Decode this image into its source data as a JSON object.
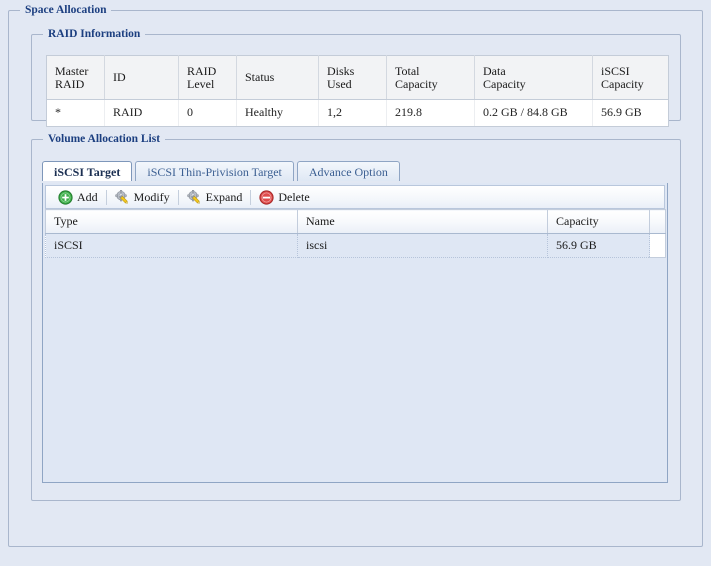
{
  "page": {
    "background": "#e2e8f3"
  },
  "space_allocation": {
    "legend": "Space Allocation",
    "raid_information": {
      "legend": "RAID Information",
      "columns": [
        {
          "line1": "Master",
          "line2": "RAID"
        },
        {
          "line1": "ID",
          "line2": ""
        },
        {
          "line1": "RAID",
          "line2": "Level"
        },
        {
          "line1": "Status",
          "line2": ""
        },
        {
          "line1": "Disks",
          "line2": "Used"
        },
        {
          "line1": "Total",
          "line2": "Capacity"
        },
        {
          "line1": "Data",
          "line2": "Capacity"
        },
        {
          "line1": "iSCSI",
          "line2": "Capacity"
        }
      ],
      "rows": [
        {
          "master_raid": "*",
          "id": "RAID",
          "raid_level": "0",
          "status": "Healthy",
          "disks_used": "1,2",
          "total_capacity": "219.8",
          "data_capacity": "0.2 GB / 84.8 GB",
          "iscsi_capacity": "56.9 GB"
        }
      ]
    },
    "volume_allocation_list": {
      "legend": "Volume Allocation List",
      "tabs": [
        {
          "label": "iSCSI Target",
          "active": true
        },
        {
          "label": "iSCSI Thin-Privision Target",
          "active": false
        },
        {
          "label": "Advance Option",
          "active": false
        }
      ],
      "toolbar": {
        "add_label": "Add",
        "modify_label": "Modify",
        "expand_label": "Expand",
        "delete_label": "Delete",
        "icons": {
          "add": "plus-circle-green-icon",
          "modify": "gear-pencil-icon",
          "expand": "gear-pencil-icon",
          "delete": "minus-circle-red-icon"
        },
        "colors": {
          "add_green": "#2e9c3a",
          "delete_red": "#d03a3a",
          "gear_gray": "#b9bdc4",
          "pencil_yellow": "#f0c419"
        }
      },
      "grid": {
        "columns": [
          "Type",
          "Name",
          "Capacity"
        ],
        "rows": [
          {
            "type": "iSCSI",
            "name": "iscsi",
            "capacity": "56.9 GB"
          }
        ]
      }
    }
  }
}
